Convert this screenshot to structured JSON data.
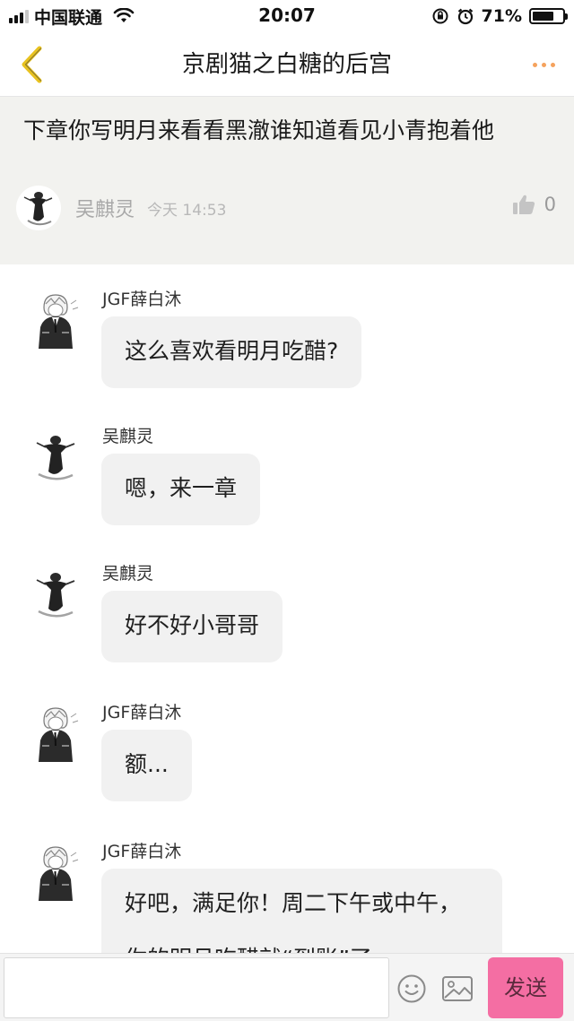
{
  "status_bar": {
    "carrier": "中国联通",
    "time": "20:07",
    "battery_percent": "71%",
    "battery_level": 0.71,
    "icons": [
      "signal-icon",
      "wifi-icon",
      "orientation-lock-icon",
      "alarm-icon",
      "battery-icon"
    ]
  },
  "nav": {
    "title": "京剧猫之白糖的后宫",
    "back_icon": "chevron-left-icon",
    "more_icon": "more-dots-icon",
    "accent_color": "#f5a25d"
  },
  "post": {
    "text": "下章你写明月来看看黑澈谁知道看见小青抱着他",
    "author": "吴麒灵",
    "time": "今天 14:53",
    "likes": "0",
    "like_icon": "thumbs-up-icon"
  },
  "messages": [
    {
      "author": "JGF薛白沐",
      "text": "这么喜欢看明月吃醋?",
      "avatar": "anime-boy-avatar"
    },
    {
      "author": "吴麒灵",
      "text": "嗯，来一章",
      "avatar": "ink-figure-avatar"
    },
    {
      "author": "吴麒灵",
      "text": "好不好小哥哥",
      "avatar": "ink-figure-avatar"
    },
    {
      "author": "JGF薛白沐",
      "text": "额...",
      "avatar": "anime-boy-avatar"
    },
    {
      "author": "JGF薛白沐",
      "text": "好吧，满足你！周二下午或中午，你的明月吃醋就“到账”了，",
      "avatar": "anime-boy-avatar"
    }
  ],
  "input": {
    "value": "",
    "send_label": "发送",
    "send_color": "#f46ea3",
    "emoji_icon": "emoji-icon",
    "image_icon": "image-icon"
  }
}
